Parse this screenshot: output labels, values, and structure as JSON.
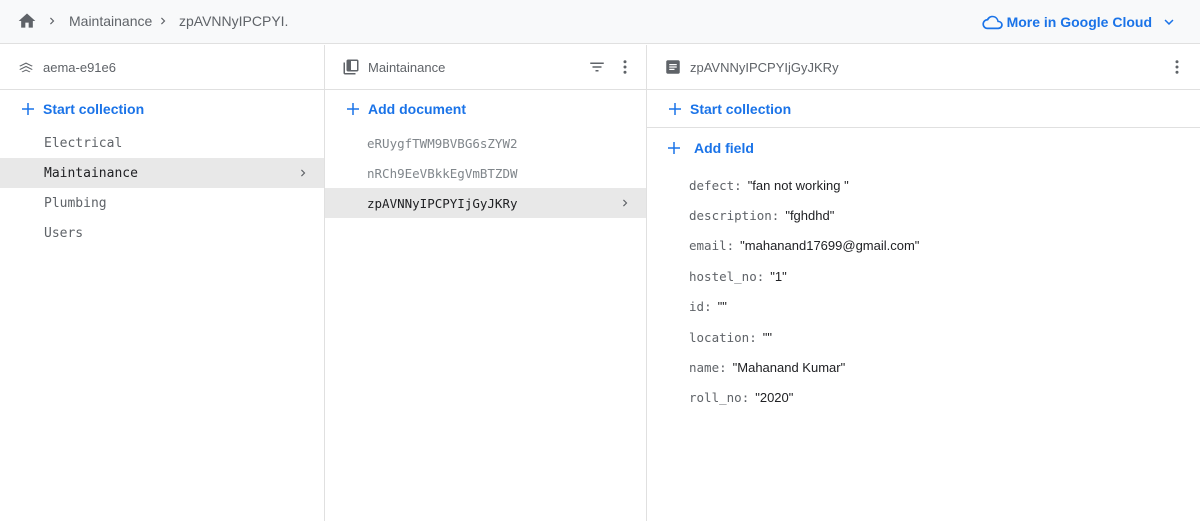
{
  "breadcrumb": {
    "items": [
      "Maintainance",
      "zpAVNNyIPCPYI."
    ]
  },
  "header": {
    "cloud_link_label": "More in Google Cloud"
  },
  "root_panel": {
    "title": "aema-e91e6",
    "action_label": "Start collection",
    "collections": [
      {
        "label": "Electrical"
      },
      {
        "label": "Maintainance",
        "selected": true
      },
      {
        "label": "Plumbing"
      },
      {
        "label": "Users"
      }
    ]
  },
  "collection_panel": {
    "title": "Maintainance",
    "action_label": "Add document",
    "documents": [
      {
        "label": "eRUygfTWM9BVBG6sZYW2"
      },
      {
        "label": "nRCh9EeVBkkEgVmBTZDW"
      },
      {
        "label": "zpAVNNyIPCPYIjGyJKRy",
        "selected": true
      }
    ]
  },
  "document_panel": {
    "title": "zpAVNNyIPCPYIjGyJKRy",
    "start_collection_label": "Start collection",
    "add_field_label": "Add field",
    "fields": [
      {
        "key": "defect",
        "value": "\"fan not working \""
      },
      {
        "key": "description",
        "value": "\"fghdhd\""
      },
      {
        "key": "email",
        "value": "\"mahanand17699@gmail.com\""
      },
      {
        "key": "hostel_no",
        "value": "\"1\""
      },
      {
        "key": "id",
        "value": "\"\""
      },
      {
        "key": "location",
        "value": "\"\""
      },
      {
        "key": "name",
        "value": "\"Mahanand Kumar\""
      },
      {
        "key": "roll_no",
        "value": "\"2020\""
      }
    ]
  },
  "icons": {
    "home": "home-icon",
    "breadcrumb_separator": "chevron-right-icon",
    "cloud": "cloud-icon",
    "expand": "chevron-down-icon",
    "database": "database-icon",
    "collection": "collection-icon",
    "document": "document-icon",
    "filter": "filter-icon",
    "more": "more-vert-icon",
    "add": "plus-icon"
  },
  "colors": {
    "accent": "#1a73e8",
    "selected_row": "#e8e8e8",
    "topbar": "#f8f9fa"
  }
}
